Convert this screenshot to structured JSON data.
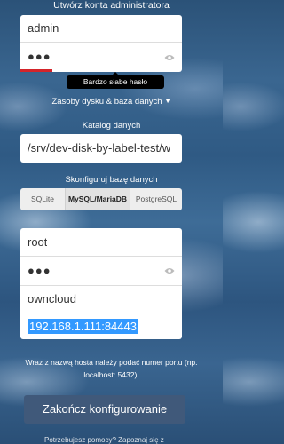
{
  "form": {
    "title": "Utwórz konta administratora",
    "admin_user": "admin",
    "admin_password_mask": "●●●",
    "password_strength": {
      "tooltip": "Bardzo słabe hasło",
      "color": "#d4242a",
      "level": 0.2
    },
    "storage_toggle": "Zasoby dysku & baza danych",
    "data_dir_label": "Katalog danych",
    "data_dir_value": "/srv/dev-disk-by-label-test/w",
    "db_label": "Skonfiguruj bazę danych",
    "db_tabs": [
      {
        "label": "SQLite",
        "selected": false
      },
      {
        "label": "MySQL/MariaDB",
        "selected": true
      },
      {
        "label": "PostgreSQL",
        "selected": false
      }
    ],
    "db_user": "root",
    "db_password_mask": "●●●",
    "db_name": "owncloud",
    "db_host": "192.168.1.111:84443",
    "host_hint": "Wraz z nazwą hosta należy podać numer portu (np. localhost: 5432).",
    "finish_button": "Zakończ konfigurowanie",
    "footer_partial": "Potrzebujesz pomocy? Zapoznaj się z"
  },
  "colors": {
    "button_bg": "#40597a",
    "selection": "#3399ff"
  },
  "icons": {
    "show_password": "eye-icon",
    "toggle_caret": "caret-down-icon"
  }
}
